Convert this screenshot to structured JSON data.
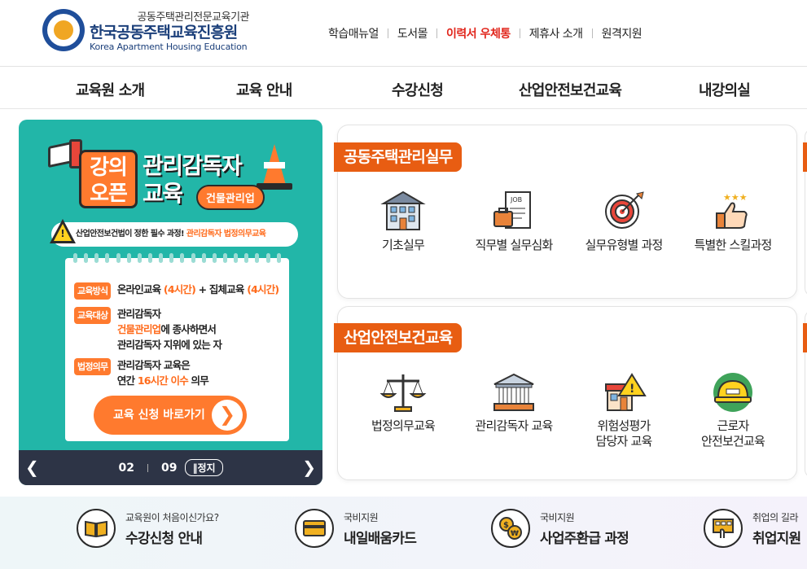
{
  "header": {
    "logo_sub": "공동주택관리전문교육기관",
    "logo_main": "한국공동주택교육진흥원",
    "logo_eng": "Korea Apartment Housing Education",
    "util_links": [
      "학습매뉴얼",
      "도서몰",
      "이력서 우체통",
      "제휴사 소개",
      "원격지원"
    ]
  },
  "gnb": {
    "items": [
      "교육원 소개",
      "교육 안내",
      "수강신청",
      "산업안전보건교육",
      "내강의실"
    ]
  },
  "banner": {
    "tag_line1": "강의",
    "tag_line2": "오픈",
    "title_line1": "관리감독자",
    "title_line2": "교육",
    "pill": "건물관리업",
    "alert_prefix": "산업안전보건법이 정한 필수 과정!",
    "alert_hl": "관리감독자 법정의무교육",
    "row1_label": "교육방식",
    "row1_a": "온라인교육",
    "row1_b": "(4시간)",
    "row1_c": "+ 집체교육",
    "row1_d": "(4시간)",
    "row2_label": "교육대상",
    "row2_line1": "관리감독자",
    "row2_line2_hl": "건물관리업",
    "row2_line2": "에 종사하면서",
    "row2_line3": "관리감독자 지위에 있는 자",
    "row3_label": "법정의무",
    "row3_line1": "관리감독자 교육은",
    "row3_line2a": "연간",
    "row3_line2b": "16시간 이수",
    "row3_line2c": "의무",
    "button": "교육 신청 바로가기",
    "button_arrow": "❯",
    "pager_current": "02",
    "pager_total": "09",
    "pager_stop": "‖정지",
    "prev": "❮",
    "next": "❯"
  },
  "cards": [
    {
      "title": "공동주택관리실무",
      "courses": [
        {
          "label": "기초실무",
          "icon": "apartment-building-icon"
        },
        {
          "label": "직무별 실무심화",
          "icon": "job-document-icon"
        },
        {
          "label": "실무유형별 과정",
          "icon": "target-icon"
        },
        {
          "label": "특별한 스킬과정",
          "icon": "thumbs-up-stars-icon"
        }
      ]
    },
    {
      "title": "산업안전보건교육",
      "courses": [
        {
          "label": "법정의무교육",
          "icon": "scales-icon"
        },
        {
          "label": "관리감독자 교육",
          "icon": "government-building-icon"
        },
        {
          "label": "위험성평가",
          "label2": "담당자 교육",
          "icon": "warning-shop-icon"
        },
        {
          "label": "근로자",
          "label2": "안전보건교육",
          "icon": "hard-hat-icon"
        }
      ]
    }
  ],
  "quick_links": [
    {
      "small": "교육원이 처음이신가요?",
      "big": "수강신청 안내",
      "icon": "open-book-icon"
    },
    {
      "small": "국비지원",
      "big": "내일배움카드",
      "icon": "card-icon"
    },
    {
      "small": "국비지원",
      "big": "사업주환급 과정",
      "icon": "money-exchange-icon"
    },
    {
      "small": "취업의 길라",
      "big": "취업지원",
      "icon": "calculator-hand-icon"
    }
  ],
  "colors": {
    "accent_orange": "#e85d12",
    "banner_teal": "#22b6a8",
    "brand_blue": "#1b3f7a",
    "util_red": "#e1251b"
  }
}
